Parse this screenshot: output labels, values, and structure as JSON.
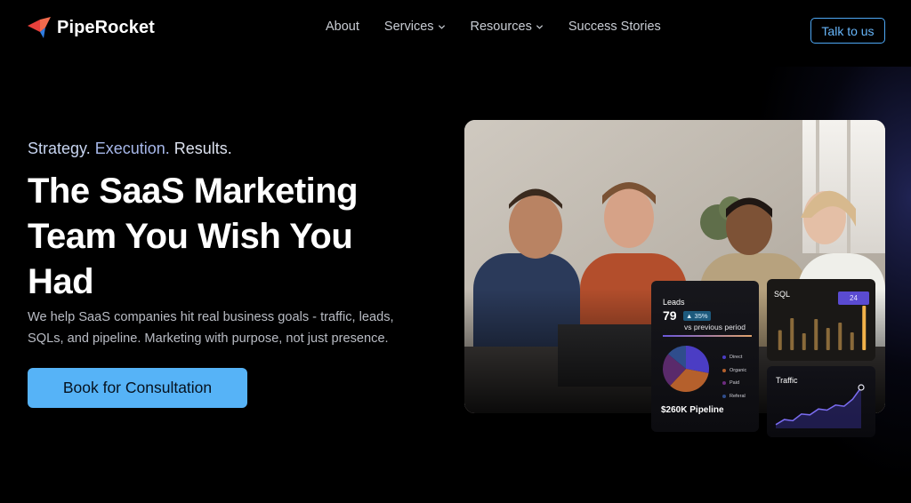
{
  "brand": {
    "name": "PipeRocket"
  },
  "nav": {
    "items": [
      {
        "label": "About",
        "has_dropdown": false
      },
      {
        "label": "Services",
        "has_dropdown": true
      },
      {
        "label": "Resources",
        "has_dropdown": true
      },
      {
        "label": "Success Stories",
        "has_dropdown": false
      }
    ],
    "cta_label": "Talk to us"
  },
  "hero": {
    "tagline": [
      "Strategy.",
      "Execution.",
      "Results."
    ],
    "headline": "The SaaS Marketing Team You Wish You Had",
    "subcopy": "We help SaaS companies hit real business goals - traffic, leads, SQLs, and pipeline. Marketing with purpose, not just presence.",
    "cta_label": "Book for Consultation"
  },
  "dashboard": {
    "leads": {
      "title": "Leads",
      "value": "79",
      "change": "35%",
      "change_icon": "up-triangle-icon",
      "comparison": "vs previous period",
      "pie": [
        {
          "label": "Direct",
          "share": 0.28,
          "color": "#4b3dc4"
        },
        {
          "label": "Organic",
          "share": 0.34,
          "color": "#b5602c"
        },
        {
          "label": "Paid",
          "share": 0.24,
          "color": "#5a2a6b"
        },
        {
          "label": "Referral",
          "share": 0.14,
          "color": "#2f4d8c"
        }
      ],
      "legend": [
        "Direct",
        "Organic",
        "Paid",
        "Referal"
      ],
      "pipeline": "$260K Pipeline"
    },
    "sql": {
      "title": "SQL",
      "badge": "24",
      "bar_levels": [
        0.45,
        0.72,
        0.38,
        0.7,
        0.5,
        0.62,
        0.4,
        1.0
      ]
    },
    "traffic": {
      "title": "Traffic",
      "trend": [
        0.05,
        0.18,
        0.15,
        0.32,
        0.3,
        0.45,
        0.42,
        0.55,
        0.52,
        0.7,
        1.0
      ]
    }
  },
  "colors": {
    "accent": "#56b3f7",
    "background": "#000000",
    "brand_red": "#e8403c",
    "brand_blue": "#2f7de1"
  }
}
